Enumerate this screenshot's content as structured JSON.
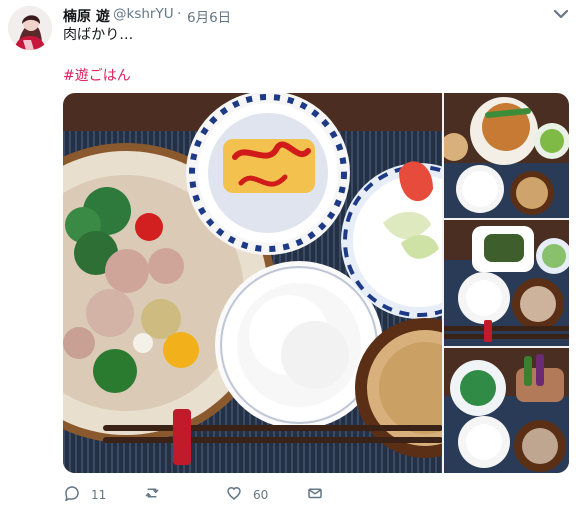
{
  "tweet": {
    "display_name": "楠原 遊",
    "handle": "@kshrYU",
    "separator": "·",
    "date": "6月6日",
    "text": "肉ばかり…",
    "hashtag": "#遊ごはん",
    "icons": {
      "avatar": "avatar-photo",
      "more": "chevron-down-icon",
      "reply": "reply-icon",
      "retweet": "retweet-icon",
      "like": "heart-icon",
      "share": "envelope-icon"
    },
    "counts": {
      "reply": "11",
      "retweet": "",
      "like": "60"
    }
  },
  "colors": {
    "text": "#14171a",
    "muted": "#657786",
    "hashtag": "#e0245e"
  }
}
